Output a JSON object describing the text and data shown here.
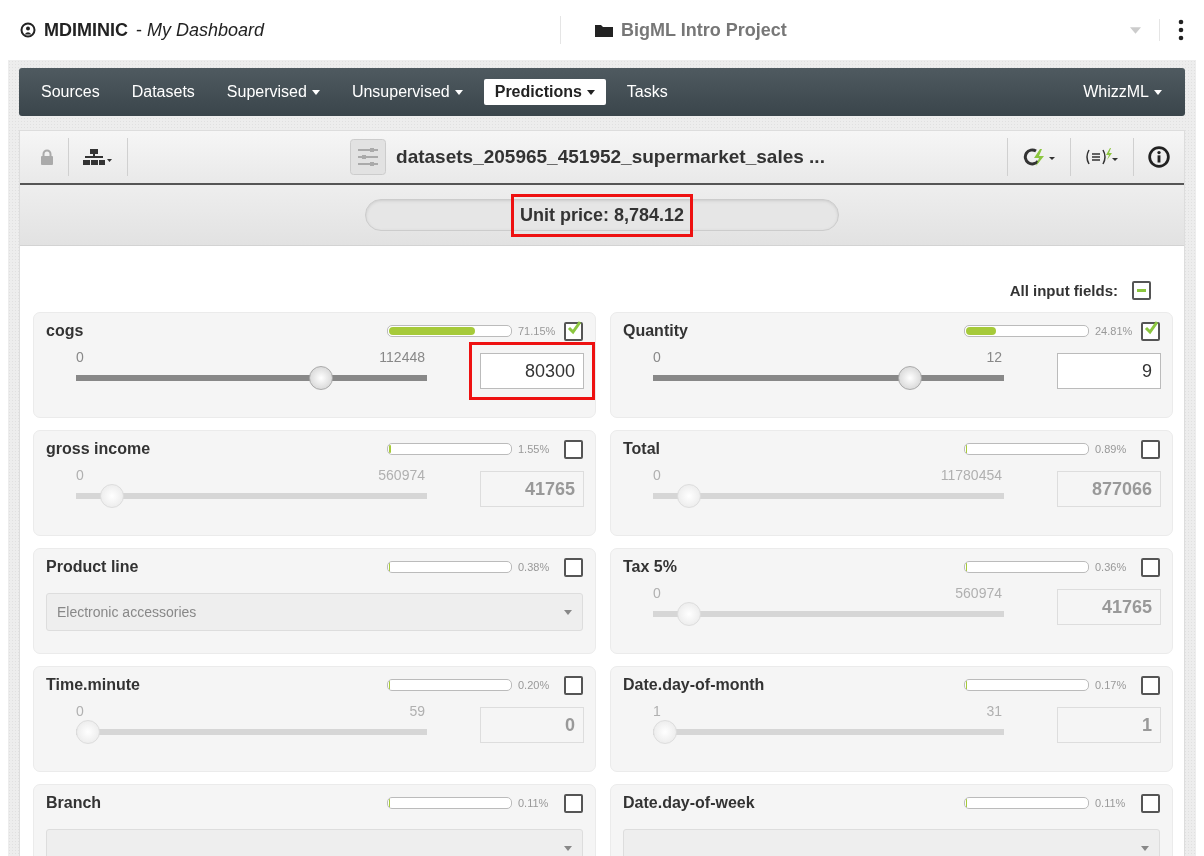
{
  "header": {
    "user": "MDIMINIC",
    "dashboard": "- *My Dashboard*",
    "project": "BigML Intro Project"
  },
  "nav": {
    "tabs": [
      {
        "label": "Sources",
        "dropdown": false,
        "selected": false
      },
      {
        "label": "Datasets",
        "dropdown": false,
        "selected": false
      },
      {
        "label": "Supervised",
        "dropdown": true,
        "selected": false
      },
      {
        "label": "Unsupervised",
        "dropdown": true,
        "selected": false
      },
      {
        "label": "Predictions",
        "dropdown": true,
        "selected": true
      },
      {
        "label": "Tasks",
        "dropdown": false,
        "selected": false
      }
    ],
    "right_tab": {
      "label": "WhizzML",
      "dropdown": true
    }
  },
  "toolbar": {
    "title": "datasets_205965_451952_supermarket_sales ..."
  },
  "prediction": {
    "text": "Unit price: 8,784.12",
    "highlighted": true
  },
  "all_fields": {
    "label": "All input fields:",
    "indeterminate": true
  },
  "fields": [
    {
      "name": "cogs",
      "kind": "slider",
      "level": 0.7115,
      "reading": "71.15%",
      "checked": true,
      "min": "0",
      "max": "112448",
      "value": "80300",
      "highlighted": true,
      "thumb": {
        "level": 0.714
      }
    },
    {
      "name": "Quantity",
      "kind": "slider",
      "level": 0.2481,
      "reading": "24.81%",
      "checked": true,
      "min": "0",
      "max": "12",
      "value": "9",
      "highlighted": false,
      "thumb": {
        "level": 0.75
      }
    },
    {
      "name": "gross income",
      "kind": "slider",
      "level": 0.0155,
      "reading": "1.55%",
      "checked": false,
      "min": "0",
      "max": "560974",
      "value": "41765",
      "highlighted": false,
      "thumb": {
        "level": 0.074
      }
    },
    {
      "name": "Total",
      "kind": "slider",
      "level": 0.0089,
      "reading": "0.89%",
      "checked": false,
      "min": "0",
      "max": "11780454",
      "value": "877066",
      "highlighted": false,
      "thumb": {
        "level": 0.074
      }
    },
    {
      "name": "Product line",
      "kind": "select",
      "level": 0.0038,
      "reading": "0.38%",
      "checked": false,
      "value": "Electronic accessories"
    },
    {
      "name": "Tax 5%",
      "kind": "slider",
      "level": 0.0036,
      "reading": "0.36%",
      "checked": false,
      "min": "0",
      "max": "560974",
      "value": "41765",
      "highlighted": false,
      "thumb": {
        "level": 0.074
      }
    },
    {
      "name": "Time.minute",
      "kind": "slider",
      "level": 0.002,
      "reading": "0.20%",
      "checked": false,
      "min": "0",
      "max": "59",
      "value": "0",
      "highlighted": false,
      "thumb": {
        "level": 0
      }
    },
    {
      "name": "Date.day-of-month",
      "kind": "slider",
      "level": 0.0017,
      "reading": "0.17%",
      "checked": false,
      "min": "1",
      "max": "31",
      "value": "1",
      "highlighted": false,
      "thumb": {
        "level": 0
      }
    },
    {
      "name": "Branch",
      "kind": "select",
      "level": 0.0011,
      "reading": "0.11%",
      "checked": false
    },
    {
      "name": "Date.day-of-week",
      "kind": "select",
      "level": 0.0011,
      "reading": "0.11%",
      "checked": false
    }
  ]
}
